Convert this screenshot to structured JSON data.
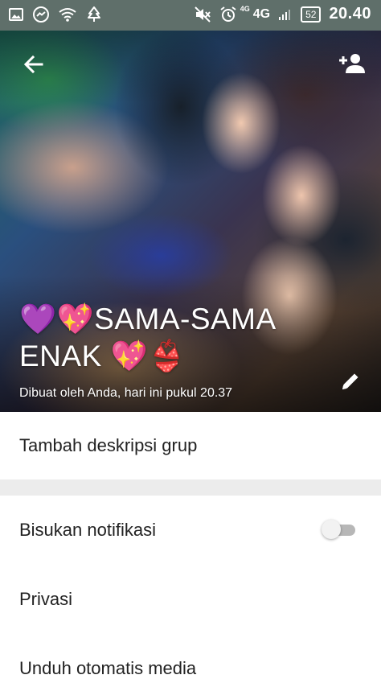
{
  "status_bar": {
    "network_sup": "4G",
    "network": "4G",
    "battery": "52",
    "time": "20.40"
  },
  "header": {
    "title": "💜💖SAMA-SAMA ENAK 💖👙",
    "created_by": "Dibuat oleh Anda, hari ini pukul 20.37"
  },
  "group_info": {
    "add_description": "Tambah deskripsi grup"
  },
  "settings": {
    "mute_label": "Bisukan notifikasi",
    "mute_enabled": false,
    "privacy_label": "Privasi",
    "auto_download_label": "Unduh otomatis media"
  },
  "icons": {
    "back": "arrow-left-icon",
    "add_participant": "add-person-icon",
    "edit": "pencil-icon"
  }
}
